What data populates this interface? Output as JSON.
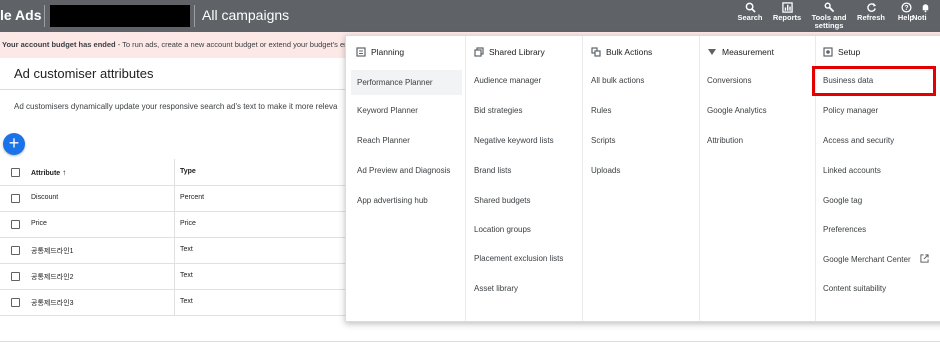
{
  "topbar": {
    "brand": "le Ads",
    "breadcrumb": "All campaigns",
    "tools": [
      {
        "label": "Search",
        "icon": "search-icon"
      },
      {
        "label": "Reports",
        "icon": "reports-icon"
      },
      {
        "label": "Tools and settings",
        "icon": "wrench-icon"
      },
      {
        "label": "Refresh",
        "icon": "refresh-icon"
      },
      {
        "label": "Help",
        "icon": "help-icon"
      },
      {
        "label": "Noti",
        "icon": "notification-icon"
      }
    ]
  },
  "alert": {
    "bold": "Your account budget has ended",
    "text": " - To run ads, create a new account budget or extend your budget's end da"
  },
  "page": {
    "title": "Ad customiser attributes",
    "description": "Ad customisers dynamically update your responsive search ad's text to make it more releva",
    "add_button": "+"
  },
  "table": {
    "headers": {
      "attribute": "Attribute",
      "type": "Type",
      "sort_icon": "↑"
    },
    "rows": [
      {
        "attribute": "Discount",
        "type": "Percent"
      },
      {
        "attribute": "Price",
        "type": "Price"
      },
      {
        "attribute": "공통제드라인1",
        "type": "Text"
      },
      {
        "attribute": "공통제드라인2",
        "type": "Text"
      },
      {
        "attribute": "공통제드라인3",
        "type": "Text"
      }
    ]
  },
  "menu": {
    "planning": {
      "title": "Planning",
      "items": [
        "Performance Planner",
        "Keyword Planner",
        "Reach Planner",
        "Ad Preview and Diagnosis",
        "App advertising hub"
      ]
    },
    "shared_library": {
      "title": "Shared Library",
      "items": [
        "Audience manager",
        "Bid strategies",
        "Negative keyword lists",
        "Brand lists",
        "Shared budgets",
        "Location groups",
        "Placement exclusion lists",
        "Asset library"
      ]
    },
    "bulk_actions": {
      "title": "Bulk Actions",
      "items": [
        "All bulk actions",
        "Rules",
        "Scripts",
        "Uploads"
      ]
    },
    "measurement": {
      "title": "Measurement",
      "items": [
        "Conversions",
        "Google Analytics",
        "Attribution"
      ]
    },
    "setup": {
      "title": "Setup",
      "items": [
        "Business data",
        "Policy manager",
        "Access and security",
        "Linked accounts",
        "Google tag",
        "Preferences",
        "Google Merchant Center",
        "Content suitability"
      ]
    }
  },
  "colors": {
    "topbar": "#5f6368",
    "accent": "#1a73e8",
    "highlight": "#e20000",
    "alert_bg": "#fce8e6"
  }
}
